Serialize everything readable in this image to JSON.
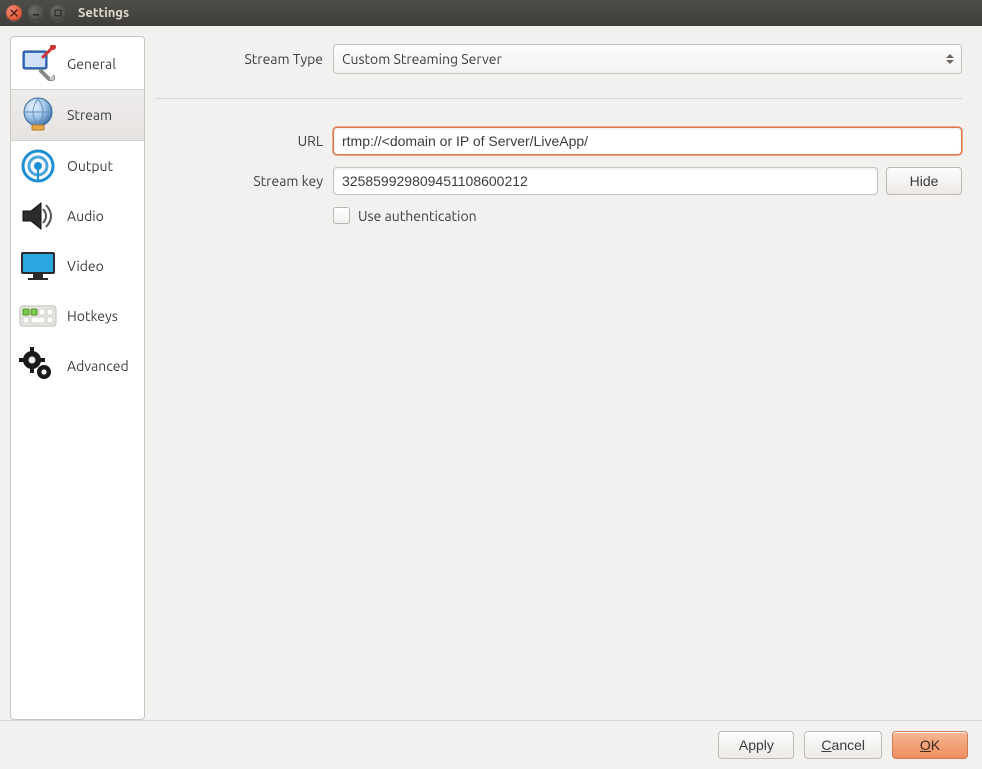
{
  "window": {
    "title": "Settings"
  },
  "sidebar": {
    "items": [
      {
        "id": "general",
        "label": "General"
      },
      {
        "id": "stream",
        "label": "Stream"
      },
      {
        "id": "output",
        "label": "Output"
      },
      {
        "id": "audio",
        "label": "Audio"
      },
      {
        "id": "video",
        "label": "Video"
      },
      {
        "id": "hotkeys",
        "label": "Hotkeys"
      },
      {
        "id": "advanced",
        "label": "Advanced"
      }
    ],
    "selected": "stream"
  },
  "form": {
    "stream_type_label": "Stream Type",
    "stream_type_value": "Custom Streaming Server",
    "url_label": "URL",
    "url_value": "rtmp://<domain or IP of Server/LiveApp/",
    "stream_key_label": "Stream key",
    "stream_key_value": "325859929809451108600212",
    "hide_button": "Hide",
    "use_auth_label": "Use authentication",
    "use_auth_checked": false
  },
  "footer": {
    "apply": "Apply",
    "cancel": "Cancel",
    "ok": "OK"
  },
  "icons": {
    "general": "general-icon",
    "stream": "stream-icon",
    "output": "output-icon",
    "audio": "audio-icon",
    "video": "video-icon",
    "hotkeys": "hotkeys-icon",
    "advanced": "advanced-icon"
  }
}
